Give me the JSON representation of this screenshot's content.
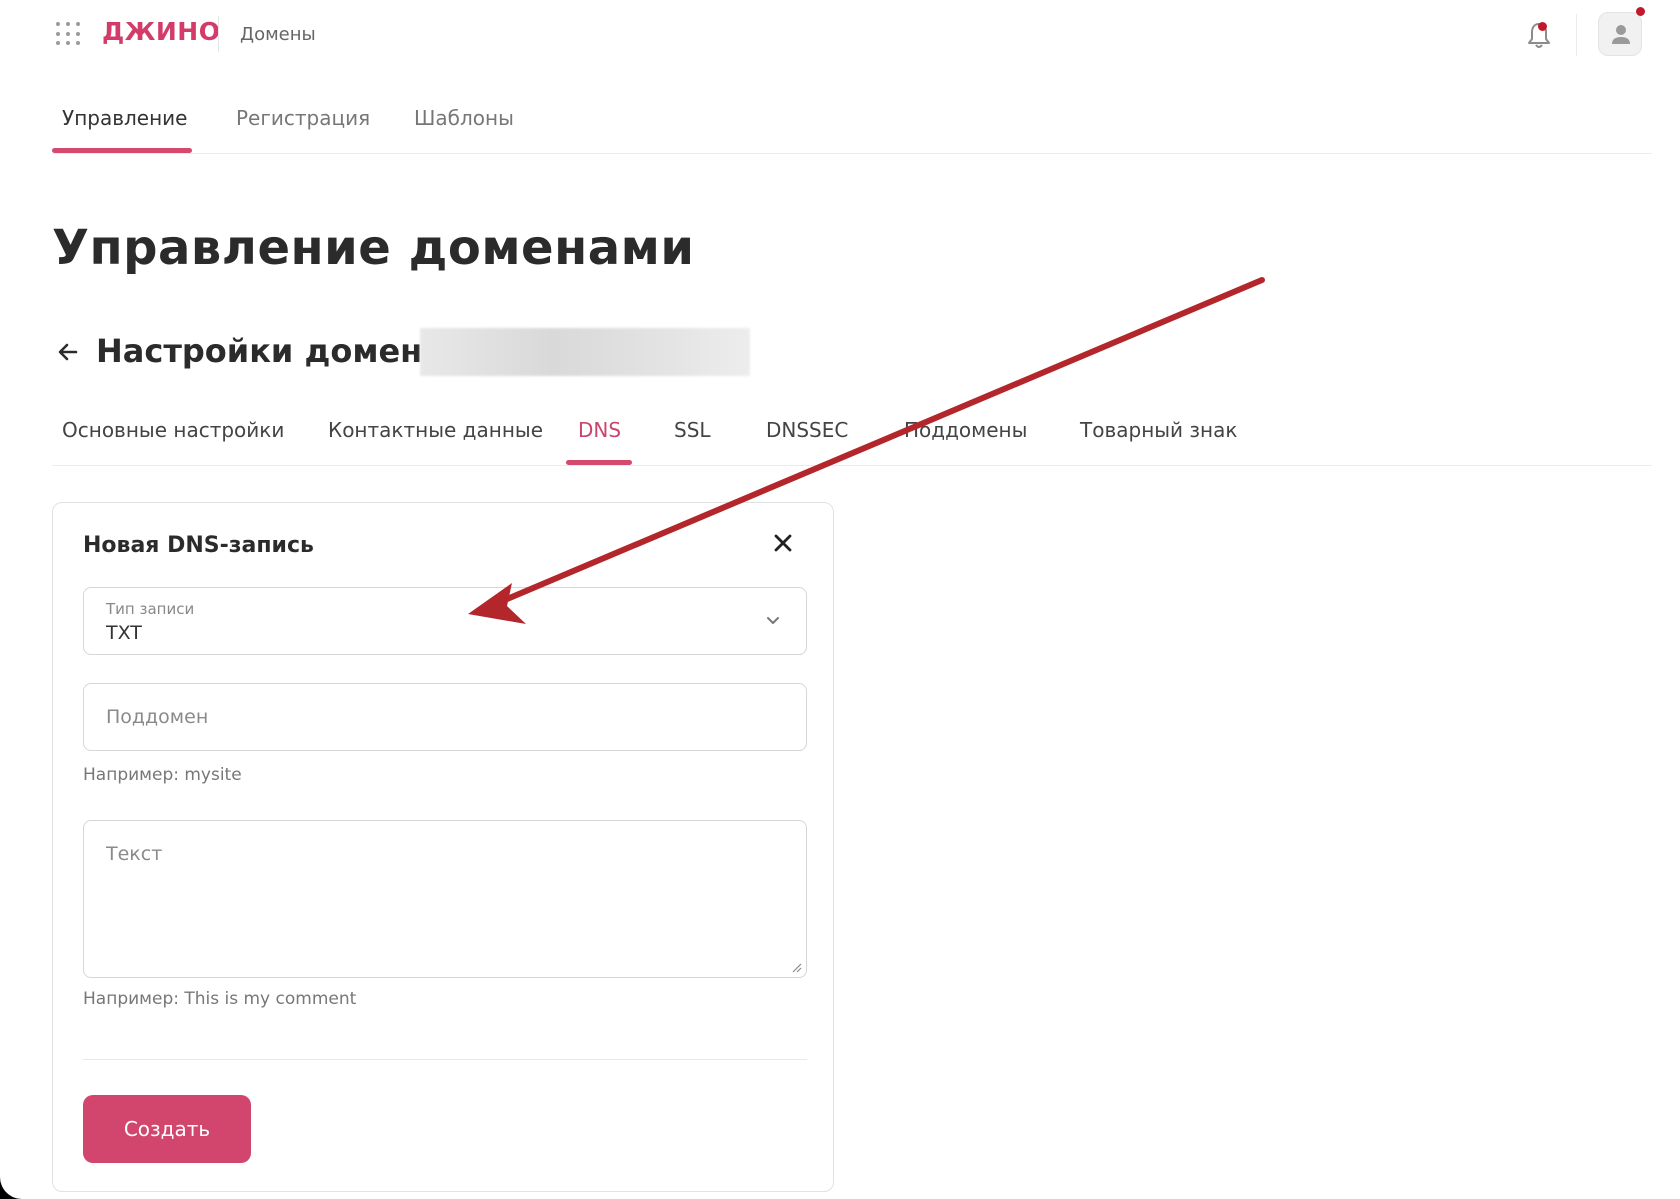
{
  "header": {
    "logo": "ДЖИНО",
    "breadcrumb": "Домены"
  },
  "top_tabs": [
    {
      "label": "Управление",
      "active": true
    },
    {
      "label": "Регистрация",
      "active": false
    },
    {
      "label": "Шаблоны",
      "active": false
    }
  ],
  "page_title": "Управление доменами",
  "domain_settings_title": "Настройки домена",
  "domain_tabs": [
    {
      "label": "Основные настройки",
      "active": false
    },
    {
      "label": "Контактные данные",
      "active": false
    },
    {
      "label": "DNS",
      "active": true
    },
    {
      "label": "SSL",
      "active": false
    },
    {
      "label": "DNSSEC",
      "active": false
    },
    {
      "label": "Поддомены",
      "active": false
    },
    {
      "label": "Товарный знак",
      "active": false
    }
  ],
  "dns_form": {
    "title": "Новая DNS-запись",
    "record_type_label": "Тип записи",
    "record_type_value": "TXT",
    "subdomain_placeholder": "Поддомен",
    "subdomain_hint": "Например: mysite",
    "text_placeholder": "Текст",
    "text_hint": "Например: This is my comment",
    "submit_label": "Создать"
  },
  "colors": {
    "accent": "#d2466d",
    "annotation_arrow": "#b3262c"
  },
  "icons": [
    "apps-grid-icon",
    "bell-icon",
    "user-icon",
    "back-arrow-icon",
    "close-icon",
    "chevron-down-icon"
  ]
}
